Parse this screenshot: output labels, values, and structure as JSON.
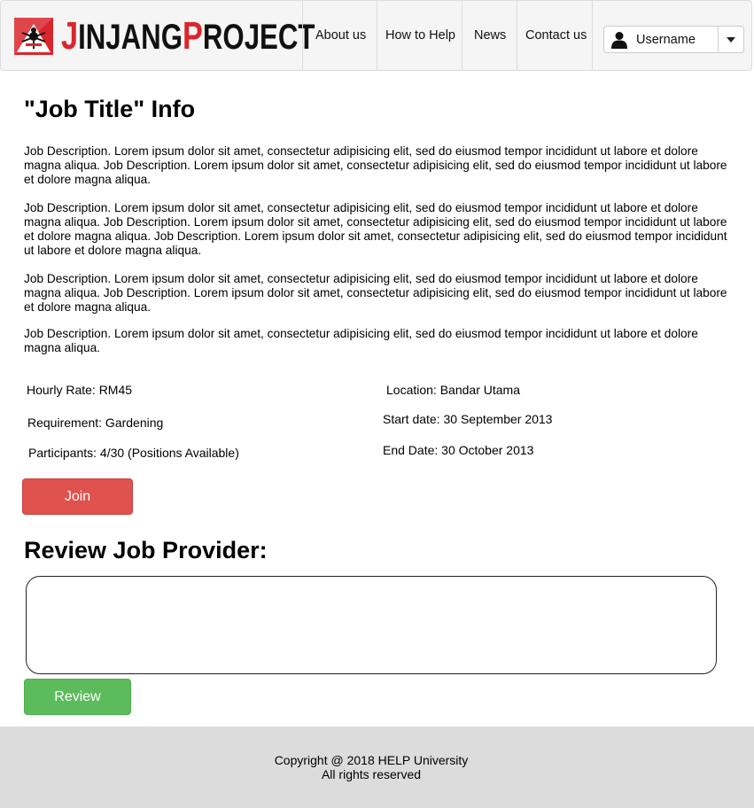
{
  "brand": {
    "first_initial": "J",
    "first_rest": "INJANG",
    "second_initial": "P",
    "second_rest": "ROJECT"
  },
  "nav": {
    "about": "About us",
    "how_to_help": "How to Help",
    "news": "News",
    "contact": "Contact us"
  },
  "user": {
    "name": "Username",
    "icon": "user-icon"
  },
  "page": {
    "title": "\"Job Title\" Info",
    "paragraphs": [
      "Job Description. Lorem ipsum dolor sit amet, consectetur adipisicing elit, sed do eiusmod tempor incididunt ut labore et dolore magna aliqua. Job Description. Lorem ipsum dolor sit amet, consectetur adipisicing elit, sed do eiusmod tempor incididunt ut labore et dolore magna aliqua.",
      " Job Description. Lorem ipsum dolor sit amet, consectetur adipisicing elit, sed do eiusmod tempor incididunt ut labore et dolore magna aliqua. Job Description. Lorem ipsum dolor sit amet, consectetur adipisicing elit, sed do eiusmod tempor incididunt ut labore et dolore magna aliqua. Job Description. Lorem ipsum dolor sit amet, consectetur adipisicing elit, sed do eiusmod tempor incididunt ut labore et dolore magna aliqua.",
      "Job Description. Lorem ipsum dolor sit amet, consectetur adipisicing elit, sed do eiusmod tempor incididunt ut labore et dolore magna aliqua. Job Description. Lorem ipsum dolor sit amet, consectetur adipisicing elit, sed do eiusmod tempor incididunt ut labore et dolore magna aliqua.",
      "Job Description. Lorem ipsum dolor sit amet, consectetur adipisicing elit, sed do eiusmod tempor incididunt ut labore et dolore magna aliqua."
    ]
  },
  "details": {
    "hourly_rate": "Hourly Rate: RM45",
    "requirement": "Requirement: Gardening",
    "participants": "Participants: 4/30 (Positions Available)",
    "location": "Location: Bandar Utama",
    "start_date": "Start date: 30 September 2013",
    "end_date": "End Date: 30 October 2013"
  },
  "actions": {
    "join_label": "Join",
    "review_label": "Review"
  },
  "review": {
    "heading": "Review Job Provider:",
    "value": ""
  },
  "footer": {
    "copyright": "Copyright @ 2018 HELP University",
    "rights": "All rights reserved"
  },
  "colors": {
    "brand_red": "#d9262c",
    "join_button": "#e0524d",
    "review_button": "#5cbc5c",
    "footer_bg": "#dcdcdc",
    "navbar_bg": "#f5f5f5"
  }
}
